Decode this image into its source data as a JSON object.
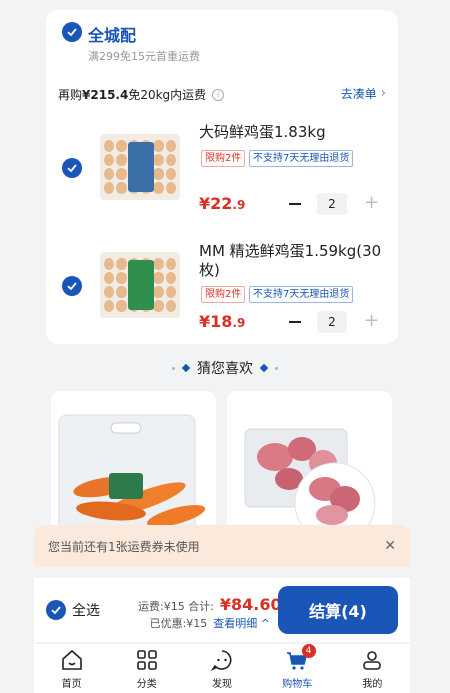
{
  "colors": {
    "accent": "#1a56b8",
    "price": "#d93026"
  },
  "shop": {
    "title": "全城配",
    "subtitle": "满299免15元首重运费"
  },
  "shipping": {
    "prefix": "再购",
    "amount": "¥215.4",
    "suffix": "免20kg内运费",
    "goto_label": "去凑单"
  },
  "products": [
    {
      "name": "大码鲜鸡蛋1.83kg",
      "tag_limit": "限购2件",
      "tag_return": "不支持7天无理由退货",
      "price_int": "¥22",
      "price_dec": ".9",
      "qty": "2"
    },
    {
      "name": "MM 精选鲜鸡蛋1.59kg(30枚)",
      "tag_limit": "限购2件",
      "tag_return": "不支持7天无理由退货",
      "price_int": "¥18",
      "price_dec": ".9",
      "qty": "2"
    }
  ],
  "recommend": {
    "title": "猜您喜欢"
  },
  "toast": {
    "text": "您当前还有1张运费券未使用"
  },
  "footer": {
    "select_all": "全选",
    "fee_label": "运费:¥15 合计:",
    "total": "¥84.60",
    "discount_label": "已优惠:¥15",
    "detail_link": "查看明细",
    "checkout": "结算(4)"
  },
  "tabs": [
    {
      "label": "首页",
      "icon": "home-icon"
    },
    {
      "label": "分类",
      "icon": "category-icon"
    },
    {
      "label": "发现",
      "icon": "discover-icon"
    },
    {
      "label": "购物车",
      "icon": "cart-icon",
      "badge": "4"
    },
    {
      "label": "我的",
      "icon": "profile-icon"
    }
  ]
}
